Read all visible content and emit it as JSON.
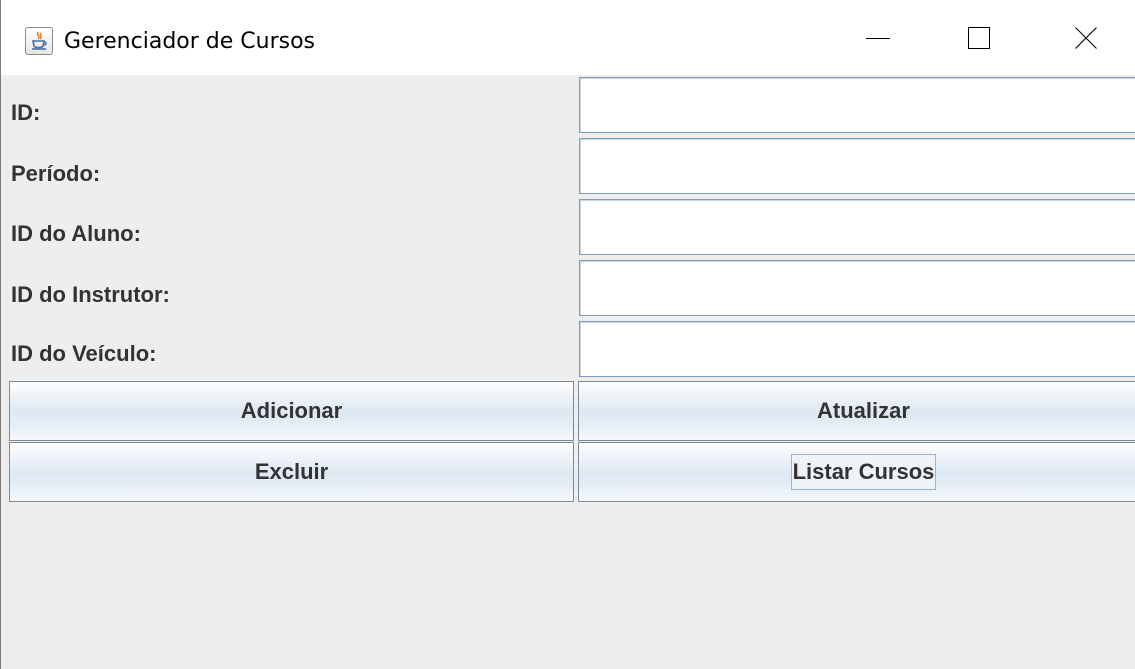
{
  "window": {
    "title": "Gerenciador de Cursos",
    "icon": "java-cup-icon",
    "controls": [
      "minimize-icon",
      "maximize-icon",
      "close-icon"
    ]
  },
  "form": {
    "fields": [
      {
        "label": "ID:",
        "value": ""
      },
      {
        "label": "Período:",
        "value": ""
      },
      {
        "label": "ID do Aluno:",
        "value": ""
      },
      {
        "label": "ID do Instrutor:",
        "value": ""
      },
      {
        "label": "ID do Veículo:",
        "value": ""
      }
    ]
  },
  "buttons": {
    "add": "Adicionar",
    "update": "Atualizar",
    "delete": "Excluir",
    "list": "Listar Cursos"
  },
  "colors": {
    "background": "#eeeeee",
    "text": "#333333",
    "input_border": "#7f9db9",
    "button_gradient_mid": "#dde8f3"
  }
}
